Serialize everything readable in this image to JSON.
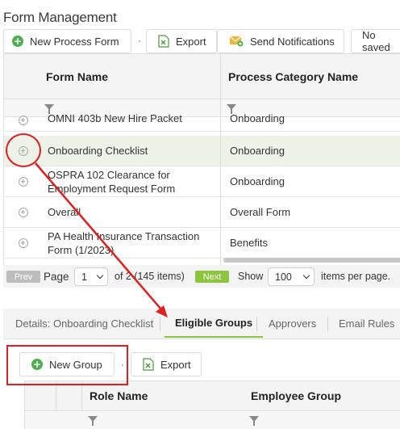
{
  "page": {
    "title": "Form Management"
  },
  "toolbar": {
    "new_process_form": "New Process Form",
    "export": "Export",
    "send_notifications": "Send Notifications",
    "saved_views": "No saved"
  },
  "grid": {
    "columns": [
      "Form Name",
      "Process Category Name"
    ],
    "rows": [
      {
        "form_name": "OMNI 403b New Hire Packet",
        "category": "Onboarding"
      },
      {
        "form_name": "Onboarding Checklist",
        "category": "Onboarding"
      },
      {
        "form_name": "OSPRA 102 Clearance for Employment Request Form",
        "category": "Onboarding"
      },
      {
        "form_name": "Overall",
        "category": "Overall Form"
      },
      {
        "form_name": "PA Health Insurance Transaction Form (1/2023)",
        "category": "Benefits"
      }
    ]
  },
  "pager": {
    "prev": "Prev",
    "page_label": "Page",
    "page_value": "1",
    "of_text": "of 2 (145 items)",
    "next": "Next",
    "show_label": "Show",
    "page_size": "100",
    "items_per_page": "items per page."
  },
  "tabs": [
    {
      "label": "Details: Onboarding Checklist",
      "active": false
    },
    {
      "label": "Eligible Groups",
      "active": true
    },
    {
      "label": "Approvers",
      "active": false
    },
    {
      "label": "Email Rules",
      "active": false
    }
  ],
  "sub_toolbar": {
    "new_group": "New Group",
    "export": "Export"
  },
  "sub_grid": {
    "columns": [
      "Role Name",
      "Employee Group"
    ]
  },
  "colors": {
    "accent_green": "#8cc63f",
    "annotation_red": "#e02020",
    "selected_row": "#eef3ea"
  }
}
